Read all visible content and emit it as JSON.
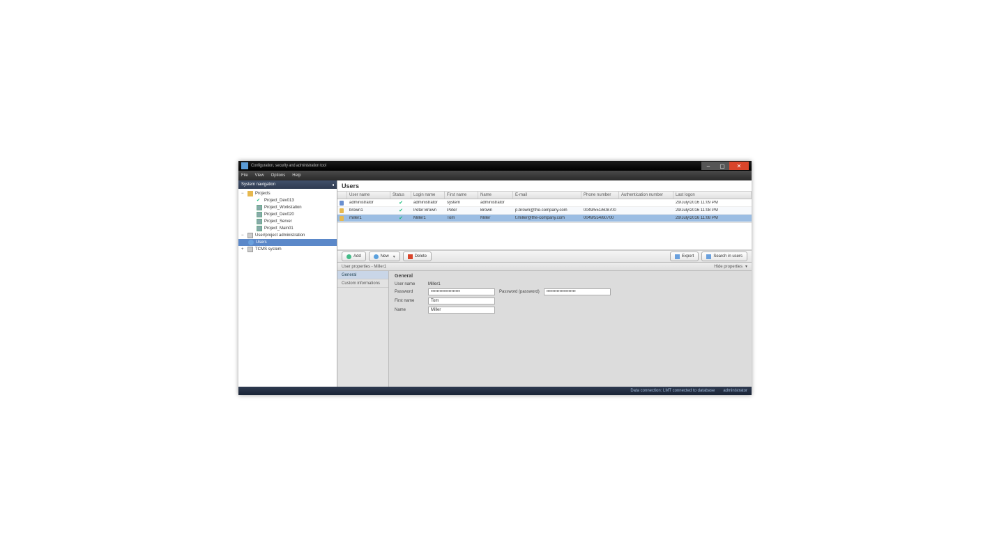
{
  "window": {
    "title": "Configuration, security and administration tool"
  },
  "menu": [
    "File",
    "View",
    "Options",
    "Help"
  ],
  "sidebar": {
    "header": "System navigation",
    "items": [
      {
        "label": "Projects",
        "icon": "folder",
        "lvl": 0,
        "expand": "−"
      },
      {
        "label": "Project_Dev013",
        "icon": "check",
        "lvl": 2
      },
      {
        "label": "Project_Workstation",
        "icon": "proj",
        "lvl": 2
      },
      {
        "label": "Project_Dev020",
        "icon": "proj",
        "lvl": 2
      },
      {
        "label": "Project_Server",
        "icon": "proj",
        "lvl": 2
      },
      {
        "label": "Project_Main01",
        "icon": "proj",
        "lvl": 2
      },
      {
        "label": "User/project administration",
        "icon": "node",
        "lvl": 0,
        "expand": "−"
      },
      {
        "label": "Users",
        "icon": "users",
        "lvl": 1,
        "selected": true
      },
      {
        "label": "TCMS system",
        "icon": "node",
        "lvl": 0,
        "expand": "+"
      }
    ]
  },
  "main": {
    "title": "Users"
  },
  "grid": {
    "headers": [
      "",
      "User name",
      "Status",
      "Login name",
      "First name",
      "Name",
      "E-mail",
      "Phone number",
      "Authentication number",
      "Last logon"
    ],
    "rows": [
      {
        "icon": "admin",
        "cells": [
          "administrator",
          "✔",
          "administrator",
          "system",
          "administrator",
          "",
          "",
          "",
          "29/July/2016 11:09 PM"
        ]
      },
      {
        "icon": "user",
        "cells": [
          "brown1",
          "✔",
          "Peter Brown",
          "Peter",
          "Brown",
          "p.brown@the-company.com",
          "0049/551/608700",
          "",
          "29/July/2016 11:08 PM"
        ]
      },
      {
        "icon": "user",
        "sel": true,
        "cells": [
          "miller1",
          "✔",
          "Miller1",
          "Tom",
          "Miller",
          "t.miller@the-company.com",
          "0049/554/60700",
          "",
          "29/July/2016 11:08 PM"
        ]
      }
    ]
  },
  "toolbar": {
    "add": "Add",
    "new": "New",
    "delete": "Delete",
    "export": "Export",
    "search": "Search in users"
  },
  "props": {
    "bar_left": "User properties - Miller1",
    "bar_right": "Hide properties",
    "tabs": [
      "General",
      "Custom informations"
    ],
    "general": {
      "heading": "General",
      "user_name_label": "User name",
      "user_name": "Miller1",
      "password_label": "Password",
      "password": "••••••••••••••••••••",
      "repeat_label": "Password (password)",
      "repeat": "••••••••••••••••••••",
      "first_name_label": "First name",
      "first_name": "Tom",
      "name_label": "Name",
      "name": "Miller"
    }
  },
  "status": {
    "left": "",
    "right1": "Data connection: LMT connected to database",
    "right2": "administrator"
  }
}
